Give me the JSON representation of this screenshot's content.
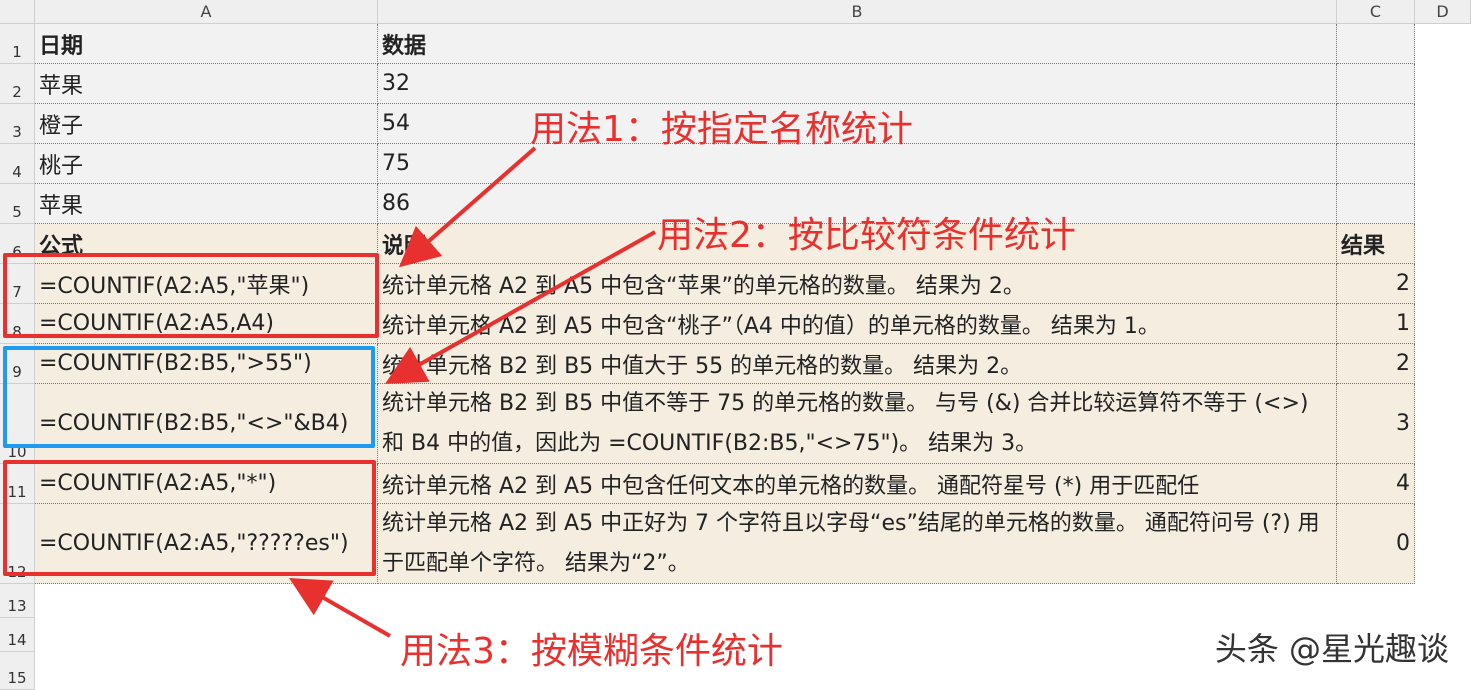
{
  "columns": [
    "A",
    "B",
    "C",
    "D"
  ],
  "rows": [
    "1",
    "2",
    "3",
    "4",
    "5",
    "6",
    "7",
    "8",
    "9",
    "10",
    "11",
    "12",
    "13",
    "14",
    "15"
  ],
  "table": {
    "header": {
      "a": "日期",
      "b": "数据"
    },
    "data": [
      {
        "a": "苹果",
        "b": "32"
      },
      {
        "a": "橙子",
        "b": "54"
      },
      {
        "a": "桃子",
        "b": "75"
      },
      {
        "a": "苹果",
        "b": "86"
      }
    ],
    "formula_header": {
      "a": "公式",
      "b": "说明",
      "c": "结果"
    },
    "formulas": [
      {
        "a": "=COUNTIF(A2:A5,\"苹果\")",
        "b": "统计单元格 A2 到 A5 中包含“苹果”的单元格的数量。 结果为 2。",
        "c": "2"
      },
      {
        "a": "=COUNTIF(A2:A5,A4)",
        "b": "统计单元格 A2 到 A5 中包含“桃子”（A4 中的值）的单元格的数量。 结果为 1。",
        "c": "1"
      },
      {
        "a": "=COUNTIF(B2:B5,\">55\")",
        "b": "统计单元格 B2 到 B5 中值大于 55 的单元格的数量。 结果为 2。",
        "c": "2"
      },
      {
        "a": "=COUNTIF(B2:B5,\"<>\"&B4)",
        "b": "统计单元格 B2 到 B5 中值不等于 75 的单元格的数量。 与号 (&) 合并比较运算符不等于 (<>) 和 B4 中的值，因此为 =COUNTIF(B2:B5,\"<>75\")。 结果为 3。",
        "c": "3"
      },
      {
        "a": "=COUNTIF(A2:A5,\"*\")",
        "b": "统计单元格 A2 到 A5 中包含任何文本的单元格的数量。 通配符星号 (*) 用于匹配任",
        "c": "4"
      },
      {
        "a": "=COUNTIF(A2:A5,\"?????es\")",
        "b": "统计单元格 A2 到 A5 中正好为 7 个字符且以字母“es”结尾的单元格的数量。 通配符问号 (?) 用于匹配单个字符。 结果为“2”。",
        "c": "0"
      }
    ]
  },
  "annotations": {
    "usage1": "用法1：按指定名称统计",
    "usage2": "用法2：按比较符条件统计",
    "usage3": "用法3：按模糊条件统计"
  },
  "watermark": "头条 @星光趣谈",
  "colors": {
    "annotation": "#e8312f",
    "highlight_blue": "#1e9bf0",
    "data_bg": "#f2f2f2",
    "formula_bg": "#f5ede0"
  }
}
